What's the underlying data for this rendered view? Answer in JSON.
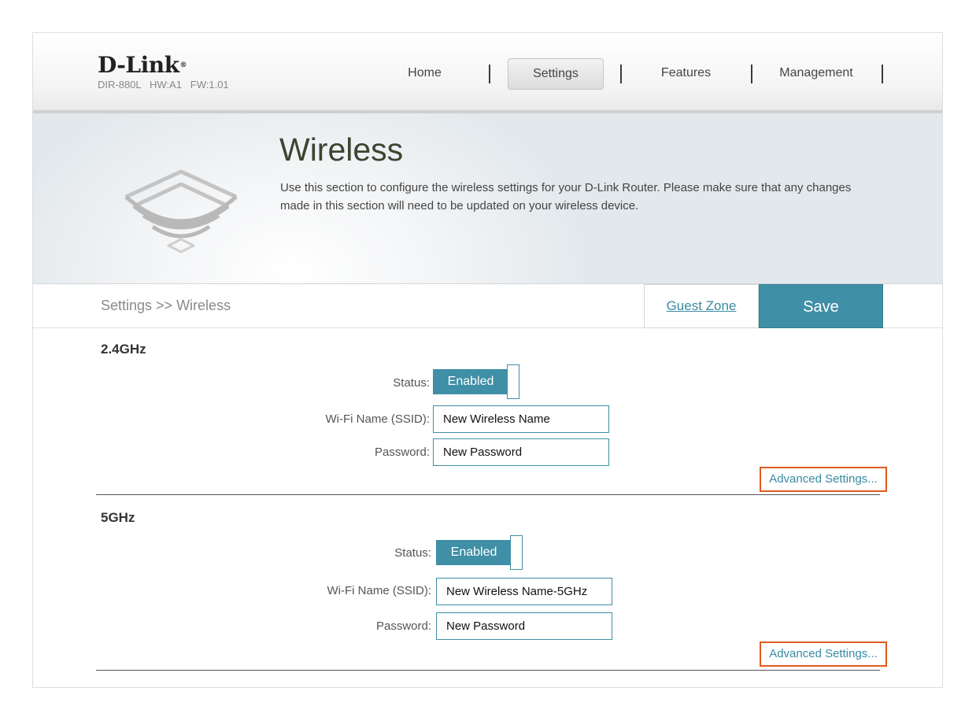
{
  "brand": {
    "logo": "D-Link",
    "model": "DIR-880L   HW:A1   FW:1.01"
  },
  "nav": {
    "items": [
      {
        "label": "Home"
      },
      {
        "label": "Settings",
        "active": true
      },
      {
        "label": "Features"
      },
      {
        "label": "Management"
      }
    ]
  },
  "hero": {
    "icon": "wifi-signal-icon",
    "title": "Wireless",
    "description": "Use this section to configure the wireless settings for your D-Link Router. Please make sure that any changes made in this section will need to be updated on your wireless device."
  },
  "toolbar": {
    "breadcrumb": "Settings >> Wireless",
    "guest_zone": "Guest Zone",
    "save": "Save"
  },
  "bands": [
    {
      "title": "2.4GHz",
      "status_label": "Status:",
      "status_value": "Enabled",
      "ssid_label": "Wi-Fi Name (SSID):",
      "ssid_value": "New Wireless Name",
      "password_label": "Password:",
      "password_value": "New Password",
      "advanced": "Advanced Settings..."
    },
    {
      "title": "5GHz",
      "status_label": "Status:",
      "status_value": "Enabled",
      "ssid_label": "Wi-Fi Name (SSID):",
      "ssid_value": "New Wireless Name-5GHz",
      "password_label": "Password:",
      "password_value": "New Password",
      "advanced": "Advanced Settings..."
    }
  ],
  "colors": {
    "accent": "#3f8fa6",
    "highlight": "#e05a1e",
    "link": "#3a8aa2"
  }
}
